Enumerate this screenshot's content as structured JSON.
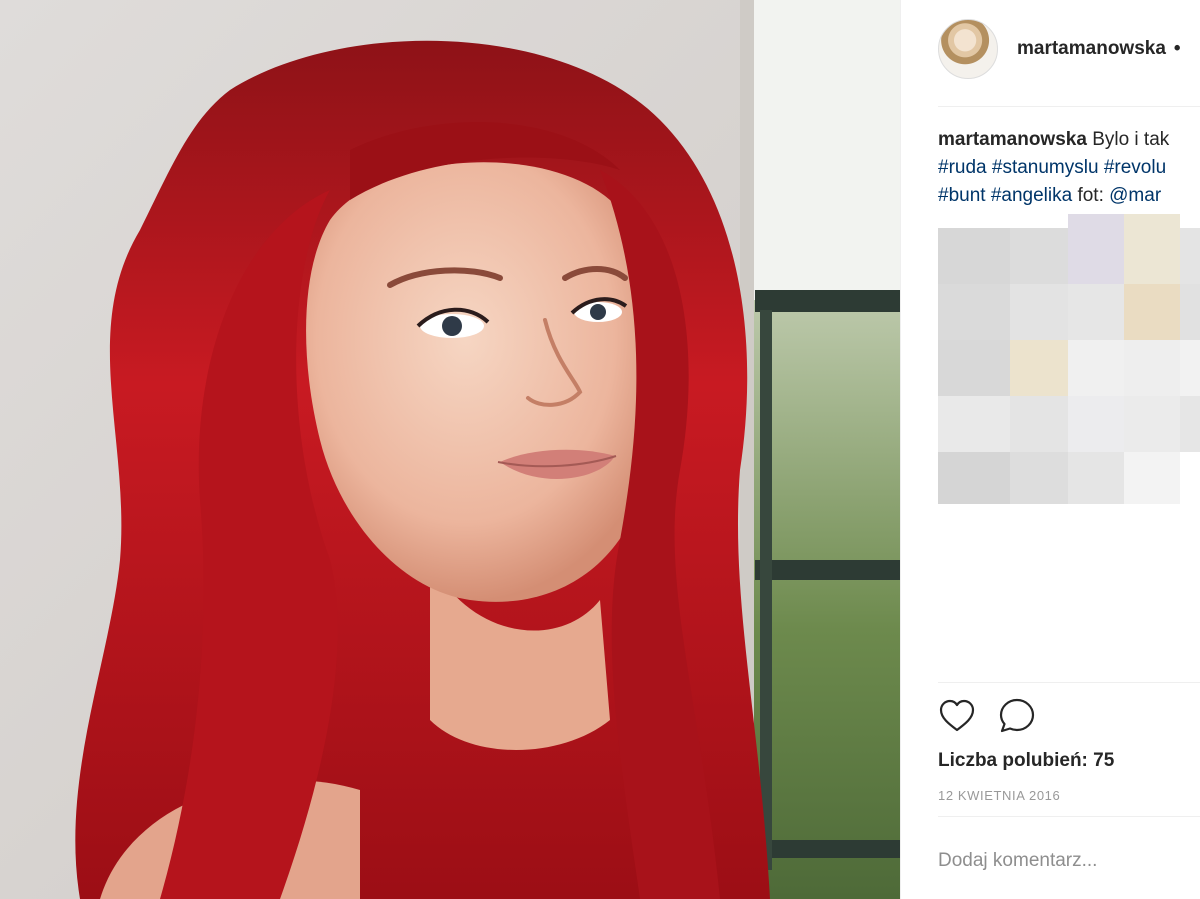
{
  "post": {
    "username": "martamanowska",
    "header_separator": "•",
    "caption": {
      "username": "martamanowska",
      "line1_text": "Bylo i tak",
      "line2_tags": [
        "#ruda",
        "#stanumyslu",
        "#revolu"
      ],
      "line3_tags": [
        "#bunt",
        "#angelika"
      ],
      "line3_suffix": "fot:",
      "line3_mention": "@mar"
    },
    "likes_label": "Liczba polubień: 75",
    "date": "12 KWIETNIA 2016",
    "comment_placeholder": "Dodaj komentarz..."
  },
  "icons": {
    "like": "heart-icon",
    "comment": "comment-bubble-icon"
  },
  "colors": {
    "text": "#262626",
    "hashtag": "#003569",
    "muted": "#999999",
    "divider": "#efefef",
    "hair": "#c0141c"
  }
}
